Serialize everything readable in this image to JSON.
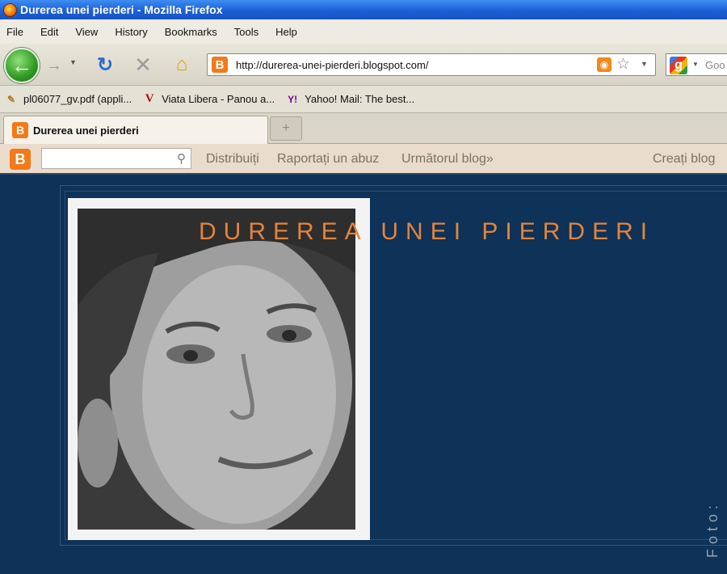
{
  "window": {
    "title": "Durerea unei pierderi - Mozilla Firefox"
  },
  "menu": [
    "File",
    "Edit",
    "View",
    "History",
    "Bookmarks",
    "Tools",
    "Help"
  ],
  "nav": {
    "url": "http://durerea-unei-pierderi.blogspot.com/",
    "search_placeholder": "Goo"
  },
  "bookmarks": [
    {
      "label": "pl06077_gv.pdf (appli...",
      "icon": "pdf-doc-icon"
    },
    {
      "label": "Viata Libera - Panou a...",
      "icon": "viata-libera-icon"
    },
    {
      "label": "Yahoo! Mail: The best...",
      "icon": "yahoo-icon"
    }
  ],
  "tab": {
    "title": "Durerea unei pierderi"
  },
  "blog_nav": {
    "links": [
      "Distribuiți",
      "Raportați un abuz",
      "Următorul blog»"
    ],
    "create": "Creați blog"
  },
  "blog": {
    "title": "DUREREA UNEI PIERDERI",
    "side_label": "Foto:"
  },
  "colors": {
    "page_bg": "#0e3258",
    "title_accent": "#e3843a",
    "blogger_orange": "#f27a19",
    "titlebar_blue": "#1c5fd6"
  }
}
